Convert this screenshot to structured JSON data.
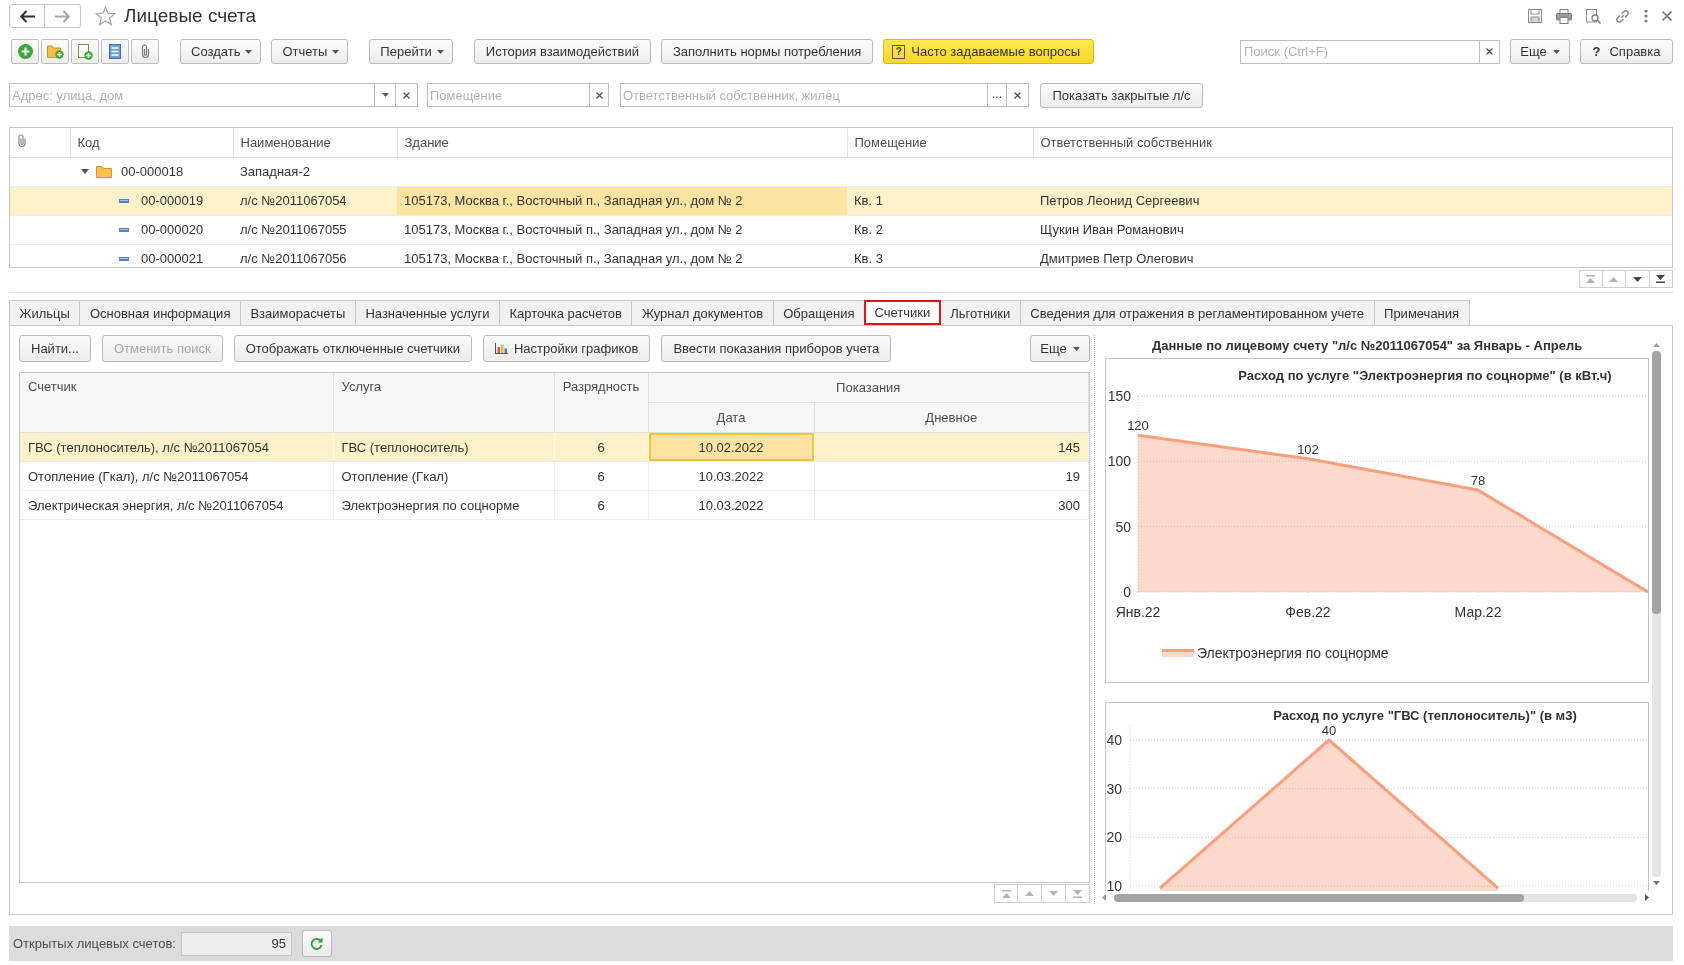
{
  "window": {
    "title": "Лицевые счета",
    "navigation": [
      {
        "kind": "back",
        "disabled": false
      },
      {
        "kind": "forward",
        "disabled": true
      }
    ]
  },
  "toolbar": {
    "button_groups": [
      {
        "buttons": [
          {
            "label": "Создать",
            "kind": "dropdown"
          },
          {
            "label": "Отчеты",
            "kind": "dropdown"
          }
        ]
      },
      {
        "buttons": [
          {
            "label": "Перейти",
            "kind": "dropdown"
          }
        ]
      },
      {
        "buttons": [
          {
            "label": "История взаимодействий",
            "kind": "plain"
          },
          {
            "label": "Заполнить нормы потребления",
            "kind": "plain"
          },
          {
            "label": "Часто задаваемые вопросы",
            "kind": "highlighted",
            "glyph": "?"
          }
        ]
      }
    ],
    "search": {
      "placeholder": "Поиск (Ctrl+F)"
    },
    "more_button": {
      "label": "Еще"
    },
    "help_button": {
      "glyph": "?",
      "label": "Справка"
    }
  },
  "filters": {
    "address": {
      "placeholder": "Адрес: улица, дом"
    },
    "premises": {
      "placeholder": "Помещение"
    },
    "owner": {
      "placeholder": "Ответственный собственник, жилец",
      "select_glyph": "..."
    },
    "show_closed_button": {
      "label": "Показать закрытые л/с"
    }
  },
  "accounts_table": {
    "columns": [
      "Код",
      "Наименование",
      "Здание",
      "Помещение",
      "Ответственный собственник"
    ],
    "rows": [
      {
        "kind": "group",
        "expanded": true,
        "selected": false,
        "cells": [
          {
            "text": "00-000018",
            "focused": false
          },
          {
            "text": "Западная-2",
            "focused": false
          }
        ],
        "children": [
          {
            "kind": "account",
            "selected": true,
            "cells": [
              {
                "text": "00-000019",
                "focused": false
              },
              {
                "text": "л/с №2011067054",
                "focused": false
              },
              {
                "text": "105173, Москва г., Восточный п., Западная ул., дом № 2",
                "focused": true
              },
              {
                "text": "Кв. 1",
                "focused": false
              },
              {
                "text": "Петров Леонид Сергеевич",
                "focused": false
              }
            ]
          },
          {
            "kind": "account",
            "selected": false,
            "cells": [
              {
                "text": "00-000020",
                "focused": false
              },
              {
                "text": "л/с №2011067055",
                "focused": false
              },
              {
                "text": "105173, Москва г., Восточный п., Западная ул., дом № 2",
                "focused": false
              },
              {
                "text": "Кв. 2",
                "focused": false
              },
              {
                "text": "Щукин Иван Романович",
                "focused": false
              }
            ]
          },
          {
            "kind": "account",
            "selected": false,
            "cells": [
              {
                "text": "00-000021",
                "focused": false
              },
              {
                "text": "л/с №2011067056",
                "focused": false
              },
              {
                "text": "105173, Москва г., Восточный п., Западная ул., дом № 2",
                "focused": false
              },
              {
                "text": "Кв. 3",
                "focused": false
              },
              {
                "text": "Дмитриев Петр Олегович",
                "focused": false
              }
            ]
          }
        ]
      }
    ],
    "scroll_buttons": [
      {
        "kind": "first",
        "disabled": true
      },
      {
        "kind": "up",
        "disabled": true
      },
      {
        "kind": "down",
        "disabled": false
      },
      {
        "kind": "last",
        "disabled": false
      }
    ]
  },
  "tabs": [
    {
      "label": "Жильцы",
      "selected": false
    },
    {
      "label": "Основная информация",
      "selected": false
    },
    {
      "label": "Взаиморасчеты",
      "selected": false
    },
    {
      "label": "Назначенные услуги",
      "selected": false
    },
    {
      "label": "Карточка расчетов",
      "selected": false
    },
    {
      "label": "Журнал документов",
      "selected": false
    },
    {
      "label": "Обращения",
      "selected": false
    },
    {
      "label": "Счетчики",
      "selected": true
    },
    {
      "label": "Льготники",
      "selected": false
    },
    {
      "label": "Сведения для отражения в регламентированном учете",
      "selected": false
    },
    {
      "label": "Примечания",
      "selected": false
    }
  ],
  "meters": {
    "toolbar": {
      "buttons": [
        {
          "label": "Найти...",
          "kind": "text",
          "disabled": false
        },
        {
          "label": "Отменить поиск",
          "kind": "text",
          "disabled": true
        },
        {
          "label": "Отображать отключенные счетчики",
          "kind": "text",
          "disabled": false
        },
        {
          "label": "Настройки графиков",
          "kind": "chart",
          "disabled": false
        },
        {
          "label": "Ввести показания приборов учета",
          "kind": "text",
          "disabled": false
        }
      ],
      "more_button": {
        "label": "Еще"
      }
    },
    "table": {
      "columns": {
        "meter": "Счетчик",
        "service": "Услуга",
        "digits": "Разрядность",
        "readings": "Показания",
        "date": "Дата",
        "day_value": "Дневное"
      },
      "rows": [
        {
          "selected": true,
          "cells": [
            {
              "text": "ГВС (теплоноситель), л/с №2011067054",
              "focused": false
            },
            {
              "text": "ГВС (теплоноситель)",
              "focused": false
            },
            {
              "text": "6",
              "focused": false
            },
            {
              "text": "10.02.2022",
              "focused": true
            },
            {
              "text": "145",
              "focused": false
            }
          ]
        },
        {
          "selected": false,
          "cells": [
            {
              "text": "Отопление (Гкал), л/с №2011067054",
              "focused": false
            },
            {
              "text": "Отопление (Гкал)",
              "focused": false
            },
            {
              "text": "6",
              "focused": false
            },
            {
              "text": "10.03.2022",
              "focused": false
            },
            {
              "text": "19",
              "focused": false
            }
          ]
        },
        {
          "selected": false,
          "cells": [
            {
              "text": "Электрическая энергия, л/с №2011067054",
              "focused": false
            },
            {
              "text": "Электроэнергия по соцнорме",
              "focused": false
            },
            {
              "text": "6",
              "focused": false
            },
            {
              "text": "10.03.2022",
              "focused": false
            },
            {
              "text": "300",
              "focused": false
            }
          ]
        }
      ],
      "scroll_buttons": [
        {
          "kind": "first",
          "disabled": true
        },
        {
          "kind": "up",
          "disabled": true
        },
        {
          "kind": "down",
          "disabled": true
        },
        {
          "kind": "last",
          "disabled": true
        }
      ]
    }
  },
  "charts_panel": {
    "title": "Данные по лицевому счету \"л/с №2011067054\" за Январь - Апрель",
    "charts": [
      {
        "chart_data": {
          "type": "area",
          "title": "Расход по услуге \"Электроэнергия по соцнорме\" (в кВт.ч)",
          "categories": [
            "Янв.22",
            "Фев.22",
            "Мар.22",
            null
          ],
          "ylim": [
            0,
            150
          ],
          "yticks": [
            0,
            50,
            100,
            150
          ],
          "grid": true,
          "series": [
            {
              "name": "Электроэнергия по соцнорме",
              "color": "#f8a07e",
              "values": [
                120,
                102,
                78,
                0
              ]
            }
          ],
          "value_labels": [
            "120",
            "102",
            "78",
            null
          ]
        }
      },
      {
        "chart_data": {
          "type": "area",
          "title": "Расход по услуге \"ГВС (теплоноситель)\" (в м3)",
          "categories": [
            null,
            null,
            null
          ],
          "ylim": [
            9,
            43
          ],
          "yticks": [
            10,
            20,
            30,
            40
          ],
          "grid": true,
          "series": [
            {
              "color": "#f8a07e",
              "values": [
                9.6,
                40,
                9.6
              ]
            }
          ],
          "value_labels": [
            null,
            "40",
            null
          ]
        }
      }
    ]
  },
  "status_bar": {
    "label": "Открытых лицевых счетов:",
    "value": "95"
  }
}
